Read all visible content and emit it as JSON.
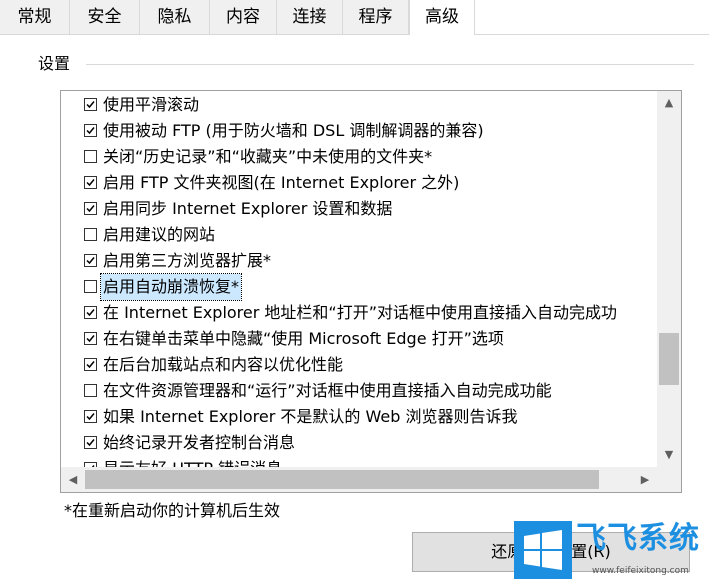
{
  "tabs": [
    {
      "label": "常规",
      "active": false
    },
    {
      "label": "安全",
      "active": false
    },
    {
      "label": "隐私",
      "active": false
    },
    {
      "label": "内容",
      "active": false
    },
    {
      "label": "连接",
      "active": false
    },
    {
      "label": "程序",
      "active": false
    },
    {
      "label": "高级",
      "active": true
    }
  ],
  "settings_group": {
    "label": "设置",
    "items": [
      {
        "label": "使用平滑滚动",
        "checked": true
      },
      {
        "label": "使用被动 FTP (用于防火墙和 DSL 调制解调器的兼容)",
        "checked": true
      },
      {
        "label": "关闭“历史记录”和“收藏夹”中未使用的文件夹*",
        "checked": false
      },
      {
        "label": "启用 FTP 文件夹视图(在 Internet Explorer 之外)",
        "checked": true
      },
      {
        "label": "启用同步 Internet Explorer 设置和数据",
        "checked": true
      },
      {
        "label": "启用建议的网站",
        "checked": false
      },
      {
        "label": "启用第三方浏览器扩展*",
        "checked": true
      },
      {
        "label": "启用自动崩溃恢复*",
        "checked": false,
        "selected": true
      },
      {
        "label": "在 Internet Explorer 地址栏和“打开”对话框中使用直接插入自动完成功",
        "checked": true
      },
      {
        "label": "在右键单击菜单中隐藏“使用 Microsoft Edge 打开”选项",
        "checked": true
      },
      {
        "label": "在后台加载站点和内容以优化性能",
        "checked": true
      },
      {
        "label": "在文件资源管理器和“运行”对话框中使用直接插入自动完成功能",
        "checked": false
      },
      {
        "label": "如果 Internet Explorer 不是默认的 Web 浏览器则告诉我",
        "checked": true
      },
      {
        "label": "始终记录开发者控制台消息",
        "checked": true
      },
      {
        "label": "显示友好 HTTP 错误消息",
        "checked": true
      }
    ]
  },
  "restart_note": "*在重新启动你的计算机后生效",
  "reset_button_label": "还原高级设置(R)",
  "watermark": {
    "text": "飞飞系统",
    "url": "www.feifeixitong.com",
    "color": "#1d8fe1"
  }
}
